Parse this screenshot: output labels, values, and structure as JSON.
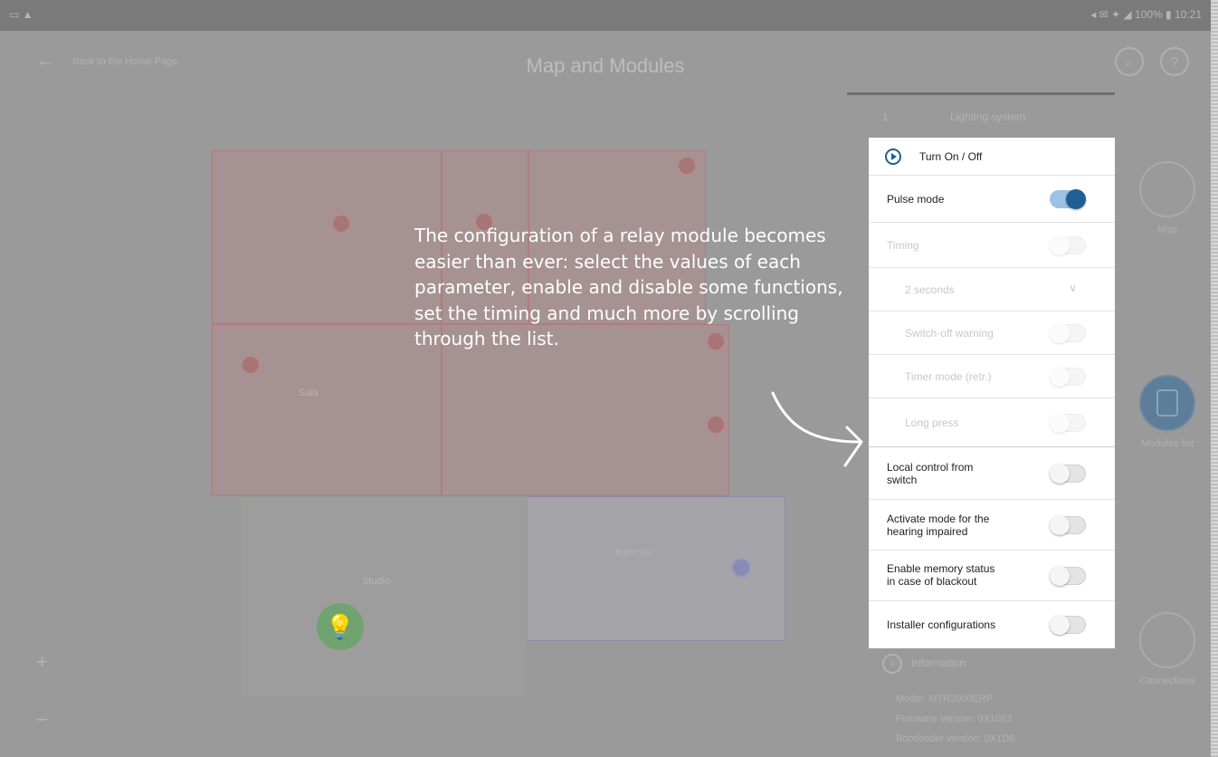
{
  "status_bar": {
    "left": "▭ ▲",
    "right": "◂ ✉ ✦ ◢ 100% ▮ 10:21"
  },
  "app_bar": {
    "back_label": "Back to the Home Page",
    "title": "Map and Modules",
    "search_icon": "search-icon",
    "help_label": "?"
  },
  "map": {
    "room_label_1": "Sala",
    "room_label_2": "Ingresso",
    "room_label_3": "Studio",
    "zoom_in": "+",
    "zoom_out": "−"
  },
  "sidebar": {
    "header_index": "1",
    "header_title": "Lighting system",
    "information_label": "Information",
    "info_lines": [
      "Model: MTR2000ERP",
      "Firmware version: 0X1023",
      "Bootloader version: 0X1D8"
    ]
  },
  "rail": {
    "items": [
      {
        "label": "Map",
        "icon": "map-icon"
      },
      {
        "label": "Modules list",
        "icon": "modules-icon"
      },
      {
        "label": "Connections",
        "icon": "connections-icon"
      }
    ]
  },
  "panel": {
    "header": "Turn On / Off",
    "rows": [
      {
        "label": "Pulse mode",
        "toggle": "on"
      },
      {
        "label": "Timing",
        "toggle": "off"
      },
      {
        "label": "2 seconds",
        "dropdown": true
      },
      {
        "label": "Switch-off warning",
        "toggle": "off"
      },
      {
        "label": "Timer mode (retr.)",
        "toggle": "off"
      },
      {
        "label": "Long press",
        "toggle": "off"
      },
      {
        "label": "Local control from switch",
        "toggle": "off"
      },
      {
        "label": "Activate mode for the hearing impaired",
        "toggle": "off"
      },
      {
        "label": "Enable memory status in case of blackout",
        "toggle": "off"
      },
      {
        "label": "Installer configurations",
        "toggle": "off"
      }
    ]
  },
  "callout": {
    "text": "The configuration of a relay module becomes easier than ever: select the values of each parameter, enable and disable some functions, set the timing and much more by scrolling through the list."
  }
}
